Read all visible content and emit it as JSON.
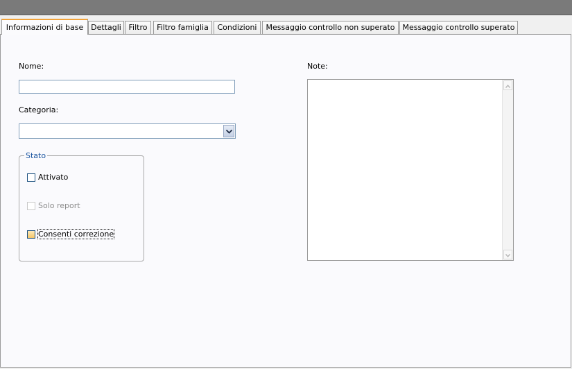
{
  "tabs": [
    {
      "label": "Informazioni di base",
      "active": true
    },
    {
      "label": "Dettagli",
      "active": false
    },
    {
      "label": "Filtro",
      "active": false
    },
    {
      "label": "Filtro famiglia",
      "active": false
    },
    {
      "label": "Condizioni",
      "active": false
    },
    {
      "label": "Messaggio controllo non superato",
      "active": false
    },
    {
      "label": "Messaggio controllo superato",
      "active": false
    }
  ],
  "form": {
    "name_label": "Nome:",
    "name_value": "",
    "category_label": "Categoria:",
    "category_value": "",
    "notes_label": "Note:",
    "notes_value": ""
  },
  "stato": {
    "legend": "Stato",
    "options": [
      {
        "label": "Attivato",
        "checked": false,
        "enabled": true
      },
      {
        "label": "Solo report",
        "checked": false,
        "enabled": false
      },
      {
        "label": "Consenti correzione",
        "checked": false,
        "enabled": true
      }
    ]
  },
  "icons": {
    "combo_arrow": "chevron-down-icon",
    "scroll_up": "scroll-up-arrow-icon",
    "scroll_down": "scroll-down-arrow-icon"
  },
  "colors": {
    "active_tab_accent": "#f2a33a",
    "group_legend": "#1a55a0",
    "title_bar": "#7a7a7a"
  }
}
